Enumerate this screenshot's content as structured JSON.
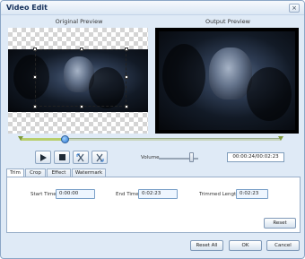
{
  "window": {
    "title": "Video Edit",
    "close_glyph": "×"
  },
  "previews": {
    "original_label": "Original Preview",
    "output_label": "Output Preview"
  },
  "playback": {
    "seek_position": 0.17,
    "volume_label": "Volume",
    "volume_level": 0.82,
    "time_display": "00:00:24/00:02:23"
  },
  "controls": [
    "play-icon",
    "stop-icon",
    "mark-in-icon",
    "mark-out-icon"
  ],
  "tabs": [
    {
      "label": "Trim",
      "active": true
    },
    {
      "label": "Crop",
      "active": false
    },
    {
      "label": "Effect",
      "active": false
    },
    {
      "label": "Watermark",
      "active": false
    }
  ],
  "trim": {
    "start_label": "Start Time",
    "start_value": "0:00:00",
    "end_label": "End Time",
    "end_value": "0:02:23",
    "length_label": "Trimmed Length",
    "length_value": "0:02:23",
    "reset_label": "Reset"
  },
  "footer": {
    "reset_all_label": "Reset All",
    "ok_label": "OK",
    "cancel_label": "Cancel"
  },
  "colors": {
    "accent": "#2f7ad2",
    "window_bg": "#dfeaf6",
    "seek_fill": "#b8cf6d"
  }
}
